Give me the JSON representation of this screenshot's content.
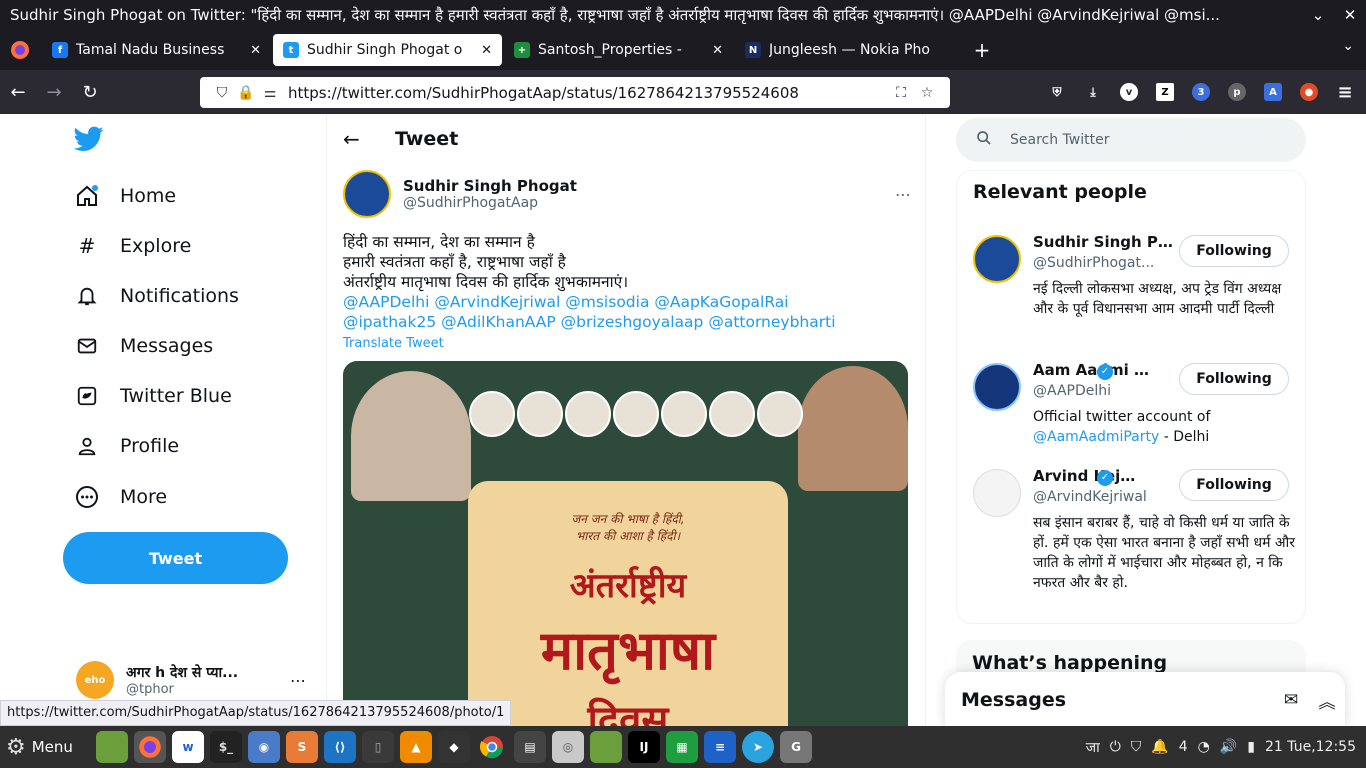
{
  "window": {
    "title": "Sudhir Singh Phogat on Twitter: \"हिंदी का सम्मान, देश का सम्मान है हमारी स्वतंत्रता कहाँ है, राष्ट्रभाषा जहाँ है अंतर्राष्ट्रीय मातृभाषा दिवस की हार्दिक शुभकामनाएं। @AAPDelhi @ArvindKejriwal @msi...",
    "minimize": "⌄",
    "close": "✕"
  },
  "tabs": [
    {
      "label": "Tamal Nadu Business",
      "favicon": "f",
      "color": "#1877f2"
    },
    {
      "label": "Sudhir Singh Phogat o",
      "favicon": "t",
      "color": "#1d9bf0"
    },
    {
      "label": "Santosh_Properties -",
      "favicon": "+",
      "color": "#1e8e3e"
    },
    {
      "label": "Jungleesh — Nokia Pho",
      "favicon": "N",
      "color": "#1c2c5e"
    }
  ],
  "navbar": {
    "url": "https://twitter.com/SudhirPhogatAap/status/1627864213795524608"
  },
  "extensions": [
    "v",
    "Z",
    "3",
    "p",
    "A",
    "●"
  ],
  "twitter": {
    "nav": [
      {
        "label": "Home",
        "icon": "⌂"
      },
      {
        "label": "Explore",
        "icon": "#"
      },
      {
        "label": "Notifications",
        "icon": "🔔"
      },
      {
        "label": "Messages",
        "icon": "✉"
      },
      {
        "label": "Twitter Blue",
        "icon": "◆"
      },
      {
        "label": "Profile",
        "icon": "👤"
      },
      {
        "label": "More",
        "icon": "⋯"
      }
    ],
    "tweet_button": "Tweet",
    "account": {
      "name": "अगर h देश से प्या...",
      "handle": "@tphor"
    },
    "header_title": "Tweet",
    "tweet": {
      "name": "Sudhir Singh Phogat",
      "handle": "@SudhirPhogatAap",
      "lines": [
        "हिंदी का सम्मान, देश का सम्मान है",
        "हमारी स्वतंत्रता कहाँ है, राष्ट्रभाषा जहाँ है",
        "अंतर्राष्ट्रीय मातृभाषा दिवस की हार्दिक शुभकामनाएं।"
      ],
      "mentions_1": "@AAPDelhi @ArvindKejriwal @msisodia @AapKaGopalRai",
      "mentions_2": "@ipathak25 @AdilKhanAAP @brizeshgoyalaap @attorneybharti",
      "translate": "Translate Tweet",
      "image_text_1": "जन जन की भाषा है हिंदी,",
      "image_text_2": "भारत की आशा है हिंदी।",
      "image_text_3": "अंतर्राष्ट्रीय",
      "image_text_4": "मातृभाषा",
      "image_text_5": "दिवस"
    },
    "search_placeholder": "Search Twitter",
    "relevant_title": "Relevant people",
    "people": [
      {
        "name": "Sudhir Singh Ph...",
        "handle": "@SudhirPhogat...",
        "button": "Following",
        "bio": "नई दिल्ली लोकसभा अध्यक्ष, अप ट्रेड विंग अध्यक्ष और के पूर्व विधानसभा आम आदमी पार्टी दिल्ली",
        "bio_mention": "",
        "bio_tail": "",
        "verified": false
      },
      {
        "name": "Aam Aadmi P...",
        "handle": "@AAPDelhi",
        "button": "Following",
        "bio": "Official twitter account of ",
        "bio_mention": "@AamAadmiParty",
        "bio_tail": " - Delhi",
        "verified": true
      },
      {
        "name": "Arvind Kejri...",
        "handle": "@ArvindKejriwal",
        "button": "Following",
        "bio": "सब इंसान बराबर हैं, चाहे वो किसी धर्म या जाति के हों. हमें एक ऐसा भारत बनाना है जहाँ सभी धर्म और जाति के लोगों में भाईचारा और मोहब्बत हो, न कि नफरत और बैर हो.",
        "bio_mention": "",
        "bio_tail": "",
        "verified": true
      }
    ],
    "whats_happening": "What’s happening",
    "messages_bar": "Messages"
  },
  "status_link": "https://twitter.com/SudhirPhogatAap/status/1627864213795524608/photo/1",
  "taskbar": {
    "menu": "Menu",
    "clock": "21 Tue,12:55",
    "lang": "जा",
    "notif_count": "4"
  }
}
